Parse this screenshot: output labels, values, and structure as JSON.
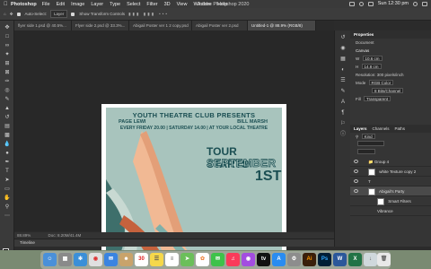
{
  "menubar": {
    "app_name": "Photoshop",
    "items": [
      "File",
      "Edit",
      "Image",
      "Layer",
      "Type",
      "Select",
      "Filter",
      "3D",
      "View",
      "Window",
      "Help"
    ],
    "window_title": "Adobe Photoshop 2020",
    "clock": "Sun 12:30 pm"
  },
  "options": {
    "auto_select_label": "Auto-Select:",
    "auto_select_value": "Layer",
    "transform_label": "Show Transform Controls",
    "more": "•••"
  },
  "tabs": [
    {
      "label": "flyer side 1.psd @ 40.5%..."
    },
    {
      "label": "Flyer side 2.psd @ 33.3%..."
    },
    {
      "label": "Abigail Poster ver 1 2 copy.psd"
    },
    {
      "label": "Abigail Poster ver 2.psd"
    },
    {
      "label": "Untitled-1 @ 88.9% (RGB/8)"
    }
  ],
  "poster": {
    "header": "YOUTH THEATRE CLUB PRESENTS",
    "name_left": "PAGE LEWI",
    "name_right": "BILL MARSH",
    "schedule": "EVERY FRIDAY 20.00 | SATURDAY 14.00 | AT YOUR LOCAL THEATRE",
    "tour_line1": "TOUR STARTS",
    "tour_line2": "SEPTEMBER",
    "tour_line3": "1ST"
  },
  "status": {
    "zoom": "88.89%",
    "doc": "Doc: 8.20M/41.4M"
  },
  "timeline_label": "Timeline",
  "properties": {
    "tab_label": "Properties",
    "doc_label": "Document",
    "section_canvas": "Canvas",
    "width_label": "W",
    "width_value": "10.6 cm",
    "height_label": "H",
    "height_value": "14.8 cm",
    "resolution": "Resolution: 300 pixels/inch",
    "mode_label": "Mode",
    "mode_value": "RGB Color",
    "bits_value": "8 Bits/Channel",
    "fill_label": "Fill",
    "fill_value": "Transparent"
  },
  "layers_panel": {
    "tabs": [
      "Layers",
      "Channels",
      "Paths"
    ],
    "kind_label": "Kind",
    "layers": [
      {
        "name": "Group 4"
      },
      {
        "name": "white Texture copy 2"
      },
      {
        "name": "T"
      },
      {
        "name": "Abigail's Party"
      },
      {
        "name": "Smart Filters"
      },
      {
        "name": "Vibrance"
      }
    ]
  },
  "dock": {
    "calendar_day": "30",
    "apps": [
      "Finder",
      "Launchpad",
      "Safari",
      "Chrome",
      "Mail",
      "Contacts",
      "Calendar",
      "Notes",
      "Reminders",
      "Maps",
      "Photos",
      "Messages",
      "Music",
      "Podcasts",
      "TV",
      "App Store",
      "System Preferences",
      "Illustrator",
      "Photoshop",
      "Word",
      "Excel",
      "Downloads",
      "Trash"
    ]
  }
}
